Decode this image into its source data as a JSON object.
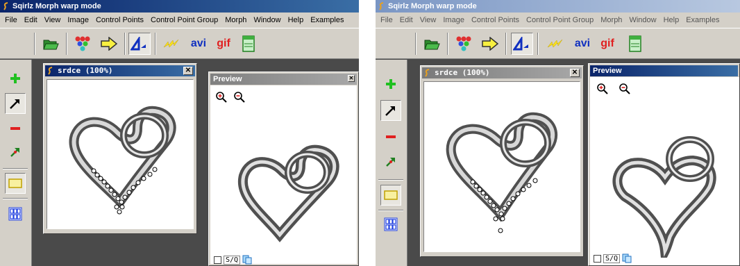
{
  "screens": [
    {
      "title": "Sqirlz Morph   warp mode",
      "menu": [
        "File",
        "Edit",
        "View",
        "Image",
        "Control Points",
        "Control Point Group",
        "Morph",
        "Window",
        "Help",
        "Examples"
      ],
      "toolbar": {
        "avi_label": "avi",
        "gif_label": "gif"
      },
      "image_window": {
        "title": "srdce (100%)",
        "close_label": "✕"
      },
      "preview": {
        "title": "Preview",
        "close_label": "✕",
        "sq_label": "S/Q"
      }
    },
    {
      "title": "Sqirlz Morph   warp mode",
      "menu": [
        "File",
        "Edit",
        "View",
        "Image",
        "Control Points",
        "Control Point Group",
        "Morph",
        "Window",
        "Help",
        "Examples"
      ],
      "toolbar": {
        "avi_label": "avi",
        "gif_label": "gif"
      },
      "image_window": {
        "title": "srdce (100%)",
        "close_label": "✕"
      },
      "preview": {
        "title": "Preview",
        "close_label": "",
        "sq_label": "S/Q"
      }
    }
  ],
  "icons": {
    "open": "open-folder-icon",
    "points": "control-points-icon",
    "arrow": "arrow-right-icon",
    "warp": "warp-mode-icon",
    "flash": "lightning-icon",
    "window": "window-icon",
    "add": "plus-icon",
    "select": "pointer-arrow-icon",
    "remove": "minus-icon",
    "move": "move-point-icon",
    "rect": "rectangle-icon",
    "grid": "grid-icon"
  },
  "colors": {
    "title_active": "#0a246a",
    "title_inactive": "#7a96c4",
    "face": "#d4d0c8",
    "workspace": "#4a4a4a"
  }
}
